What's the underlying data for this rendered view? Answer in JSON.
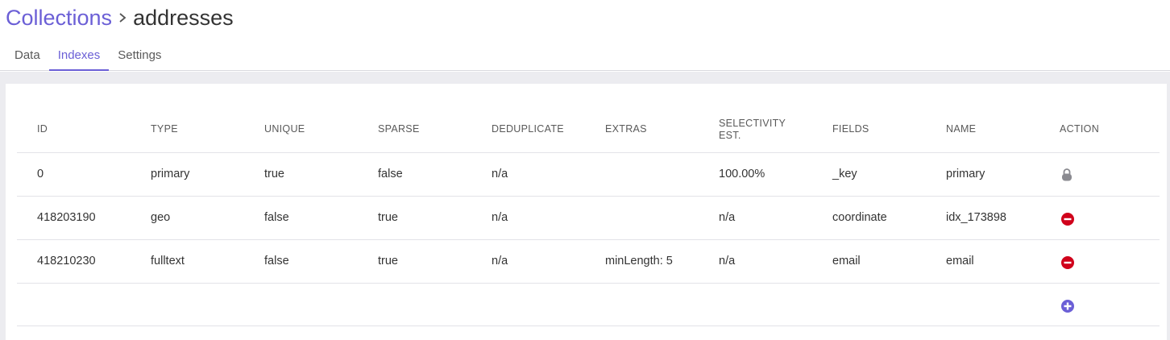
{
  "breadcrumb": {
    "root": "Collections",
    "separator_icon": "chevron-right-icon",
    "current": "addresses"
  },
  "tabs": [
    {
      "label": "Data",
      "active": false
    },
    {
      "label": "Indexes",
      "active": true
    },
    {
      "label": "Settings",
      "active": false
    }
  ],
  "table": {
    "columns": [
      "ID",
      "TYPE",
      "UNIQUE",
      "SPARSE",
      "DEDUPLICATE",
      "EXTRAS",
      "SELECTIVITY EST.",
      "FIELDS",
      "NAME",
      "ACTION"
    ],
    "rows": [
      {
        "id": "0",
        "type": "primary",
        "unique": "true",
        "sparse": "false",
        "deduplicate": "n/a",
        "extras": "",
        "selectivity": "100.00%",
        "fields": "_key",
        "name": "primary",
        "action_icon": "lock-icon"
      },
      {
        "id": "418203190",
        "type": "geo",
        "unique": "false",
        "sparse": "true",
        "deduplicate": "n/a",
        "extras": "",
        "selectivity": "n/a",
        "fields": "coordinate",
        "name": "idx_173898",
        "action_icon": "delete-icon"
      },
      {
        "id": "418210230",
        "type": "fulltext",
        "unique": "false",
        "sparse": "true",
        "deduplicate": "n/a",
        "extras": "minLength: 5",
        "selectivity": "n/a",
        "fields": "email",
        "name": "email",
        "action_icon": "delete-icon"
      }
    ],
    "add_icon": "add-index-icon"
  },
  "colors": {
    "accent": "#6b5fd6",
    "danger": "#d0021b",
    "lock": "#8a8a90",
    "background": "#ececf0"
  }
}
